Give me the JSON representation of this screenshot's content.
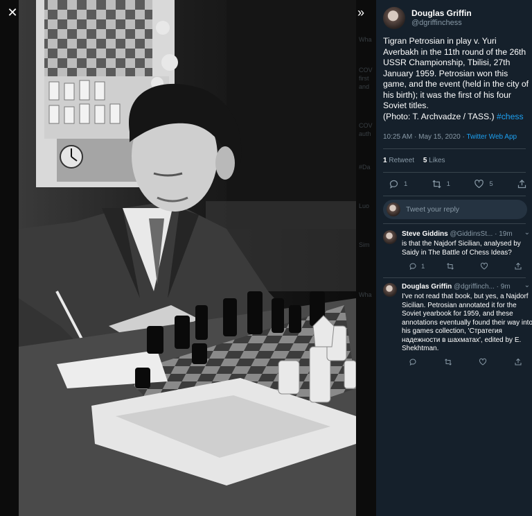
{
  "viewer": {
    "close_icon": "close-icon",
    "collapse_icon": "double-chevron-right-icon",
    "background_feed_fragments": [
      "Wha",
      "COV",
      "first",
      "and",
      "COV",
      "auth",
      "#Da",
      "Luo",
      "Sim",
      "Wha"
    ]
  },
  "tweet": {
    "display_name": "Douglas Griffin",
    "handle": "@dgriffinchess",
    "text": "Tigran Petrosian in play v. Yuri Averbakh in the 11th round of the 26th USSR Championship, Tbilisi, 27th January 1959. Petrosian won this game, and the event (held in the city of his birth); it was the first of his four Soviet titles.\n(Photo: T. Archvadze / TASS.) ",
    "hashtag": "#chess",
    "timestamp": "10:25 AM · May 15, 2020 · ",
    "source": "Twitter Web App",
    "retweet_count": "1",
    "retweet_label": "Retweet",
    "like_count": "5",
    "like_label": "Likes",
    "actions": {
      "reply_count": "1",
      "retweet_count": "1",
      "like_count": "5"
    }
  },
  "reply_box": {
    "placeholder": "Tweet your reply"
  },
  "replies": [
    {
      "display_name": "Steve Giddins",
      "handle": "@GiddinsSt...",
      "time": " · 19m",
      "text": "is that the Najdorf Sicilian, analysed by Saidy in The Battle of Chess Ideas?",
      "reply_count": "1",
      "retweet_count": "",
      "like_count": ""
    },
    {
      "display_name": "Douglas Griffin",
      "handle": "@dgriffinch...",
      "time": " · 9m",
      "text": "I've not read that book, but yes, a Najdorf Sicilian. Petrosian annotated it for the Soviet yearbook for 1959, and these annotations eventually found their way into his games collection, 'Стратегия надежности в шахматах', edited by E. Shekhtman.",
      "reply_count": "",
      "retweet_count": "",
      "like_count": ""
    }
  ],
  "colors": {
    "sidebar_bg": "#15202b",
    "link": "#1da1f2",
    "muted": "#8899a6",
    "divider": "#38444d"
  }
}
